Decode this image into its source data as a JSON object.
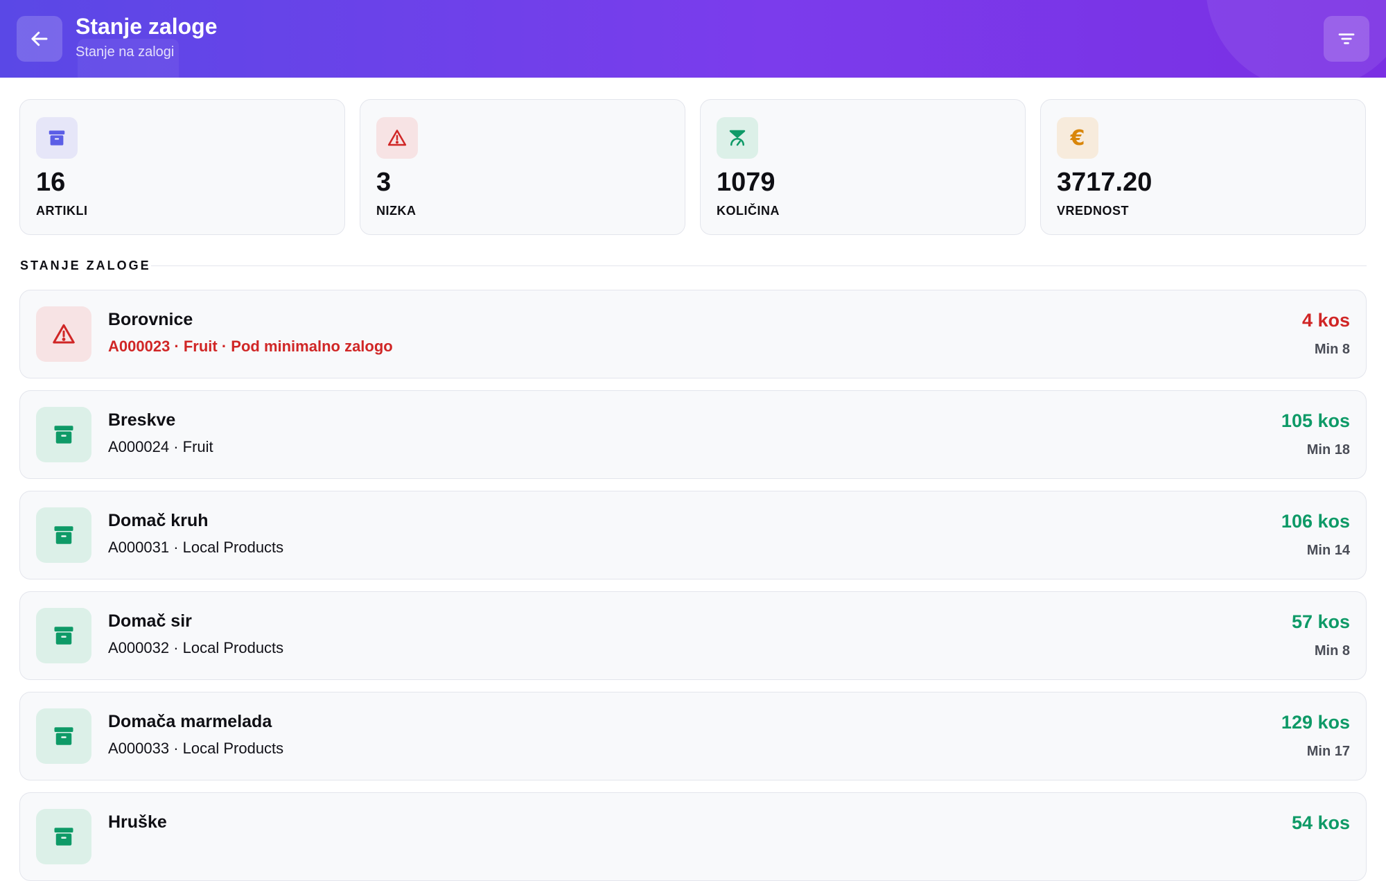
{
  "header": {
    "title": "Stanje zaloge",
    "subtitle": "Stanje na zalogi",
    "back_icon": "arrow-left-icon",
    "filter_icon": "filter-icon"
  },
  "colors": {
    "header_start": "#5a48e6",
    "header_end": "#7a2fe3",
    "ok": "#0e9a67",
    "low": "#d02626",
    "indigo": "#5b5ee6",
    "amber": "#d9860a"
  },
  "stats": [
    {
      "value": "16",
      "label": "ARTIKLI",
      "icon": "archive-box-icon",
      "color": "#5b5ee6",
      "bg": "#e6e6f8"
    },
    {
      "value": "3",
      "label": "NIZKA",
      "icon": "warning-triangle-icon",
      "color": "#d02626",
      "bg": "#f7e3e4"
    },
    {
      "value": "1079",
      "label": "KOLIČINA",
      "icon": "scale-icon",
      "color": "#0e9a67",
      "bg": "#dcf0e8"
    },
    {
      "value": "3717.20",
      "label": "VREDNOST",
      "icon": "euro-icon",
      "color": "#d9860a",
      "bg": "#f7ebdc"
    }
  ],
  "section": {
    "title": "STANJE ZALOGE"
  },
  "items": [
    {
      "name": "Borovnice",
      "meta": "A000023 · Fruit · Pod minimalno zalogo",
      "qty": "4 kos",
      "min": "Min 8",
      "low": true
    },
    {
      "name": "Breskve",
      "meta": "A000024 · Fruit",
      "qty": "105 kos",
      "min": "Min 18",
      "low": false
    },
    {
      "name": "Domač kruh",
      "meta": "A000031 · Local Products",
      "qty": "106 kos",
      "min": "Min 14",
      "low": false
    },
    {
      "name": "Domač sir",
      "meta": "A000032 · Local Products",
      "qty": "57 kos",
      "min": "Min 8",
      "low": false
    },
    {
      "name": "Domača marmelada",
      "meta": "A000033 · Local Products",
      "qty": "129 kos",
      "min": "Min 17",
      "low": false
    },
    {
      "name": "Hruške",
      "meta": "",
      "qty": "54 kos",
      "min": "",
      "low": false
    }
  ]
}
